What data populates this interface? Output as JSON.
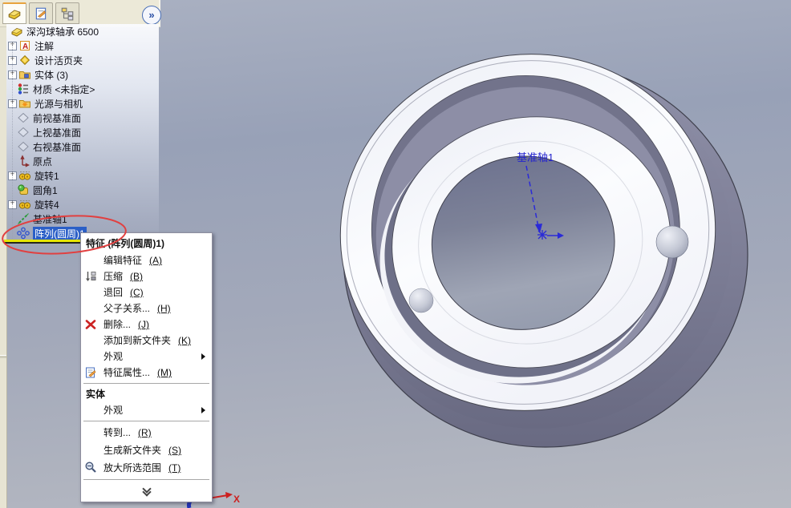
{
  "app": {
    "name_note": "cad-feature-tree-with-context-menu"
  },
  "panel": {
    "tabs": [
      {
        "icon": "feature-manager-part-icon"
      },
      {
        "icon": "property-manager-icon"
      },
      {
        "icon": "configuration-manager-icon"
      }
    ],
    "collapse_label": "»",
    "tree": {
      "root": {
        "label": "深沟球轴承 6500",
        "icon": "part-icon"
      },
      "items": [
        {
          "label": "注解",
          "icon": "annotations-icon",
          "expandable": true
        },
        {
          "label": "设计活页夹",
          "icon": "design-binder-icon",
          "expandable": true
        },
        {
          "label": "实体 (3)",
          "icon": "solid-bodies-folder-icon",
          "expandable": true
        },
        {
          "label": "材质 <未指定>",
          "icon": "material-icon",
          "expandable": false
        },
        {
          "label": "光源与相机",
          "icon": "lights-cameras-folder-icon",
          "expandable": true
        },
        {
          "label": "前视基准面",
          "icon": "plane-icon",
          "expandable": false
        },
        {
          "label": "上视基准面",
          "icon": "plane-icon",
          "expandable": false
        },
        {
          "label": "右视基准面",
          "icon": "plane-icon",
          "expandable": false
        },
        {
          "label": "原点",
          "icon": "origin-icon",
          "expandable": false
        },
        {
          "label": "旋转1",
          "icon": "revolve-icon",
          "expandable": true
        },
        {
          "label": "圆角1",
          "icon": "fillet-icon",
          "expandable": false
        },
        {
          "label": "旋转4",
          "icon": "revolve-icon",
          "expandable": true
        },
        {
          "label": "基准轴1",
          "icon": "axis-icon",
          "expandable": false
        },
        {
          "label": "阵列(圆周)1",
          "icon": "circular-pattern-icon",
          "expandable": false,
          "selected": true
        }
      ]
    }
  },
  "context_menu": {
    "header": "特征 (阵列(圆周)1)",
    "groups": [
      {
        "items": [
          {
            "label": "编辑特征",
            "shortcut": "(A)"
          },
          {
            "label": "压缩",
            "shortcut": "(B)",
            "icon": "suppress-icon"
          },
          {
            "label": "退回",
            "shortcut": "(C)"
          },
          {
            "label": "父子关系...",
            "shortcut": "(H)"
          },
          {
            "label": "删除...",
            "shortcut": "(J)",
            "icon": "delete-icon"
          },
          {
            "label": "添加到新文件夹",
            "shortcut": "(K)"
          },
          {
            "label": "外观",
            "submenu": true
          },
          {
            "label": "特征属性...",
            "shortcut": "(M)",
            "icon": "feature-properties-icon"
          }
        ]
      },
      {
        "header": "实体",
        "items": [
          {
            "label": "外观",
            "submenu": true
          }
        ]
      },
      {
        "items": [
          {
            "label": "转到...",
            "shortcut": "(R)"
          },
          {
            "label": "生成新文件夹",
            "shortcut": "(S)"
          },
          {
            "label": "放大所选范围",
            "shortcut": "(T)",
            "icon": "zoom-selection-icon"
          }
        ]
      }
    ]
  },
  "viewport": {
    "axis_label": "基准轴1",
    "triad_x_label": "X",
    "model": "deep-groove-ball-bearing"
  },
  "colors": {
    "selection_blue": "#2b5fc7",
    "annotation_red": "#e14040",
    "axis_blue": "#2323cf",
    "viewport_top": "#98a1b7",
    "viewport_bottom": "#b7bac2",
    "ring_side": "#76778f",
    "ring_face": "#f7f8fc",
    "panel_cream": "#ece9d8"
  }
}
